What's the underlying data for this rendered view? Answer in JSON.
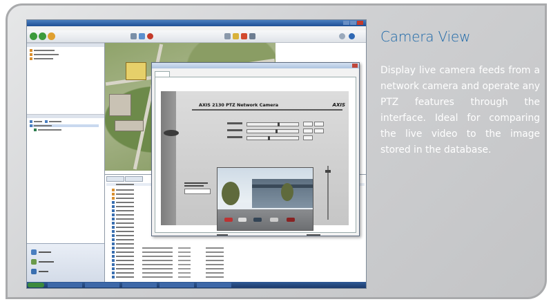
{
  "panel": {
    "heading": "Camera View",
    "description": "Display live camera feeds from a network camera and operate any PTZ features through the interface. Ideal for comparing the live video to the image stored in the database."
  },
  "camera_page": {
    "model_title": "AXIS 2130 PTZ Network Camera",
    "brand": "AXIS"
  },
  "colors": {
    "heading": "#1d68a8",
    "frame_border": "#a9aaac",
    "panel_background": "#cfd0d2",
    "description_text": "#ffffff"
  }
}
